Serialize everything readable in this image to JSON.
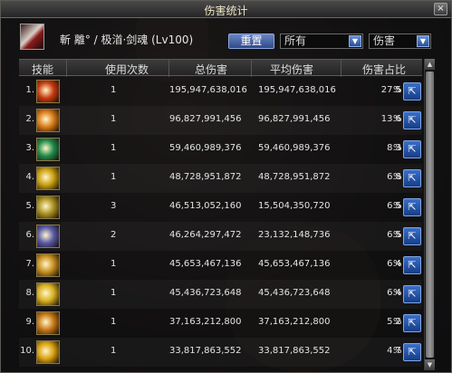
{
  "window": {
    "title": "伤害统计",
    "close_label": "×"
  },
  "character": {
    "name": "斬 離° / 极渞·剑魂 (Lv100)"
  },
  "toolbar": {
    "reset_label": "重置",
    "scope_value": "所有",
    "type_value": "伤害"
  },
  "columns": {
    "skill": "技能",
    "count": "使用次数",
    "total": "总伤害",
    "avg": "平均伤害",
    "ratio": "伤害占比"
  },
  "percent_sign": "%",
  "rows": [
    {
      "index": "1.",
      "count": "1",
      "total": "195,947,638,016",
      "avg": "195,947,638,016",
      "ratio": "27.5",
      "icon": "flame-burst-icon",
      "color": "#c83a10"
    },
    {
      "index": "2.",
      "count": "1",
      "total": "96,827,991,456",
      "avg": "96,827,991,456",
      "ratio": "13.6",
      "icon": "radiant-slash-icon",
      "color": "#d87a18"
    },
    {
      "index": "3.",
      "count": "1",
      "total": "59,460,989,376",
      "avg": "59,460,989,376",
      "ratio": "8.3",
      "icon": "jade-glyph-icon",
      "color": "#1f8a4a"
    },
    {
      "index": "4.",
      "count": "1",
      "total": "48,728,951,872",
      "avg": "48,728,951,872",
      "ratio": "6.8",
      "icon": "golden-star-slash-icon",
      "color": "#c8a010"
    },
    {
      "index": "5.",
      "count": "3",
      "total": "46,513,052,160",
      "avg": "15,504,350,720",
      "ratio": "6.5",
      "icon": "blade-strike-icon",
      "color": "#a89020"
    },
    {
      "index": "6.",
      "count": "2",
      "total": "46,264,297,472",
      "avg": "23,132,148,736",
      "ratio": "6.5",
      "icon": "crescent-slash-icon",
      "color": "#5a5aa8"
    },
    {
      "index": "7.",
      "count": "1",
      "total": "45,653,467,136",
      "avg": "45,653,467,136",
      "ratio": "6.4",
      "icon": "arc-wave-icon",
      "color": "#c89020"
    },
    {
      "index": "8.",
      "count": "1",
      "total": "45,436,723,648",
      "avg": "45,436,723,648",
      "ratio": "6.4",
      "icon": "spark-burst-icon",
      "color": "#d8b020"
    },
    {
      "index": "9.",
      "count": "1",
      "total": "37,163,212,800",
      "avg": "37,163,212,800",
      "ratio": "5.2",
      "icon": "whirl-slash-icon",
      "color": "#c87818"
    },
    {
      "index": "10.",
      "count": "1",
      "total": "33,817,863,552",
      "avg": "33,817,863,552",
      "ratio": "4.7",
      "icon": "golden-ring-icon",
      "color": "#d8a010"
    }
  ]
}
